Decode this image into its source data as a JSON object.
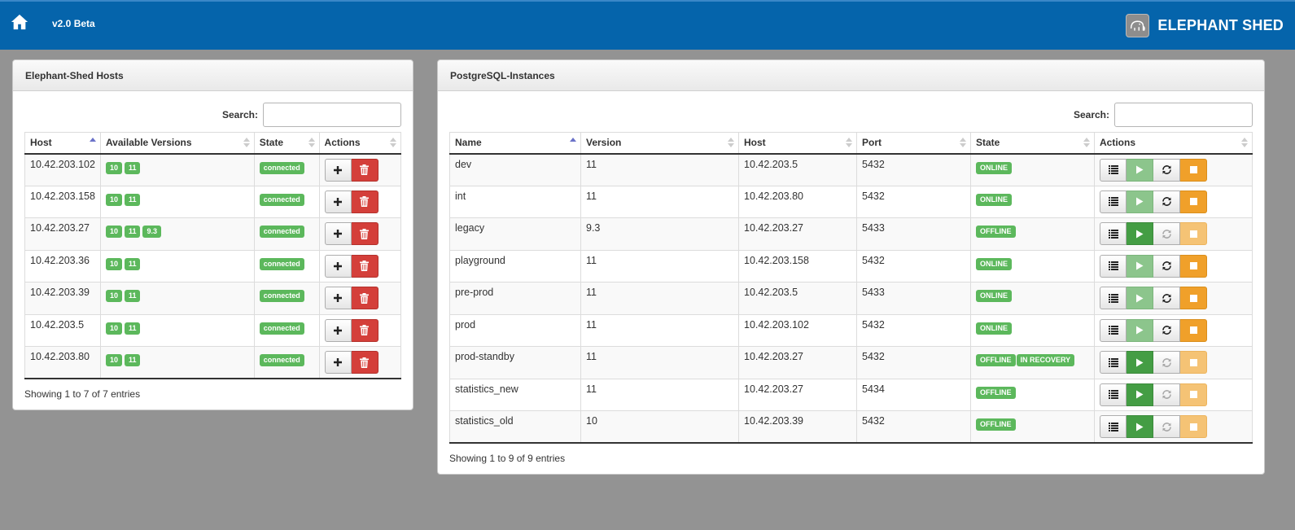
{
  "header": {
    "version": "v2.0 Beta",
    "brand": "ELEPHANT SHED"
  },
  "hosts_panel": {
    "title": "Elephant-Shed Hosts",
    "search_label": "Search:",
    "search_value": "",
    "columns": [
      "Host",
      "Available Versions",
      "State",
      "Actions"
    ],
    "rows": [
      {
        "host": "10.42.203.102",
        "versions": [
          "10",
          "11"
        ],
        "state": "connected"
      },
      {
        "host": "10.42.203.158",
        "versions": [
          "10",
          "11"
        ],
        "state": "connected"
      },
      {
        "host": "10.42.203.27",
        "versions": [
          "10",
          "11",
          "9.3"
        ],
        "state": "connected"
      },
      {
        "host": "10.42.203.36",
        "versions": [
          "10",
          "11"
        ],
        "state": "connected"
      },
      {
        "host": "10.42.203.39",
        "versions": [
          "10",
          "11"
        ],
        "state": "connected"
      },
      {
        "host": "10.42.203.5",
        "versions": [
          "10",
          "11"
        ],
        "state": "connected"
      },
      {
        "host": "10.42.203.80",
        "versions": [
          "10",
          "11"
        ],
        "state": "connected"
      }
    ],
    "info": "Showing 1 to 7 of 7 entries"
  },
  "instances_panel": {
    "title": "PostgreSQL-Instances",
    "search_label": "Search:",
    "search_value": "",
    "columns": [
      "Name",
      "Version",
      "Host",
      "Port",
      "State",
      "Actions"
    ],
    "rows": [
      {
        "name": "dev",
        "version": "11",
        "host": "10.42.203.5",
        "port": "5432",
        "states": [
          "ONLINE"
        ],
        "online": true
      },
      {
        "name": "int",
        "version": "11",
        "host": "10.42.203.80",
        "port": "5432",
        "states": [
          "ONLINE"
        ],
        "online": true
      },
      {
        "name": "legacy",
        "version": "9.3",
        "host": "10.42.203.27",
        "port": "5433",
        "states": [
          "OFFLINE"
        ],
        "online": false
      },
      {
        "name": "playground",
        "version": "11",
        "host": "10.42.203.158",
        "port": "5432",
        "states": [
          "ONLINE"
        ],
        "online": true
      },
      {
        "name": "pre-prod",
        "version": "11",
        "host": "10.42.203.5",
        "port": "5433",
        "states": [
          "ONLINE"
        ],
        "online": true
      },
      {
        "name": "prod",
        "version": "11",
        "host": "10.42.203.102",
        "port": "5432",
        "states": [
          "ONLINE"
        ],
        "online": true
      },
      {
        "name": "prod-standby",
        "version": "11",
        "host": "10.42.203.27",
        "port": "5432",
        "states": [
          "OFFLINE",
          "IN RECOVERY"
        ],
        "online": false
      },
      {
        "name": "statistics_new",
        "version": "11",
        "host": "10.42.203.27",
        "port": "5434",
        "states": [
          "OFFLINE"
        ],
        "online": false
      },
      {
        "name": "statistics_old",
        "version": "10",
        "host": "10.42.203.39",
        "port": "5432",
        "states": [
          "OFFLINE"
        ],
        "online": false
      }
    ],
    "info": "Showing 1 to 9 of 9 entries"
  },
  "colors": {
    "header": "#0564ab",
    "background": "#939393",
    "success": "#5cb85c",
    "danger": "#d9534f",
    "info": "#5bc0de",
    "warning": "#f0a02a"
  },
  "icons": {
    "home": "home-icon",
    "add": "plus-icon",
    "delete": "trash-icon",
    "details": "list-icon",
    "start": "play-icon",
    "restart": "refresh-icon",
    "stop": "stop-icon"
  }
}
